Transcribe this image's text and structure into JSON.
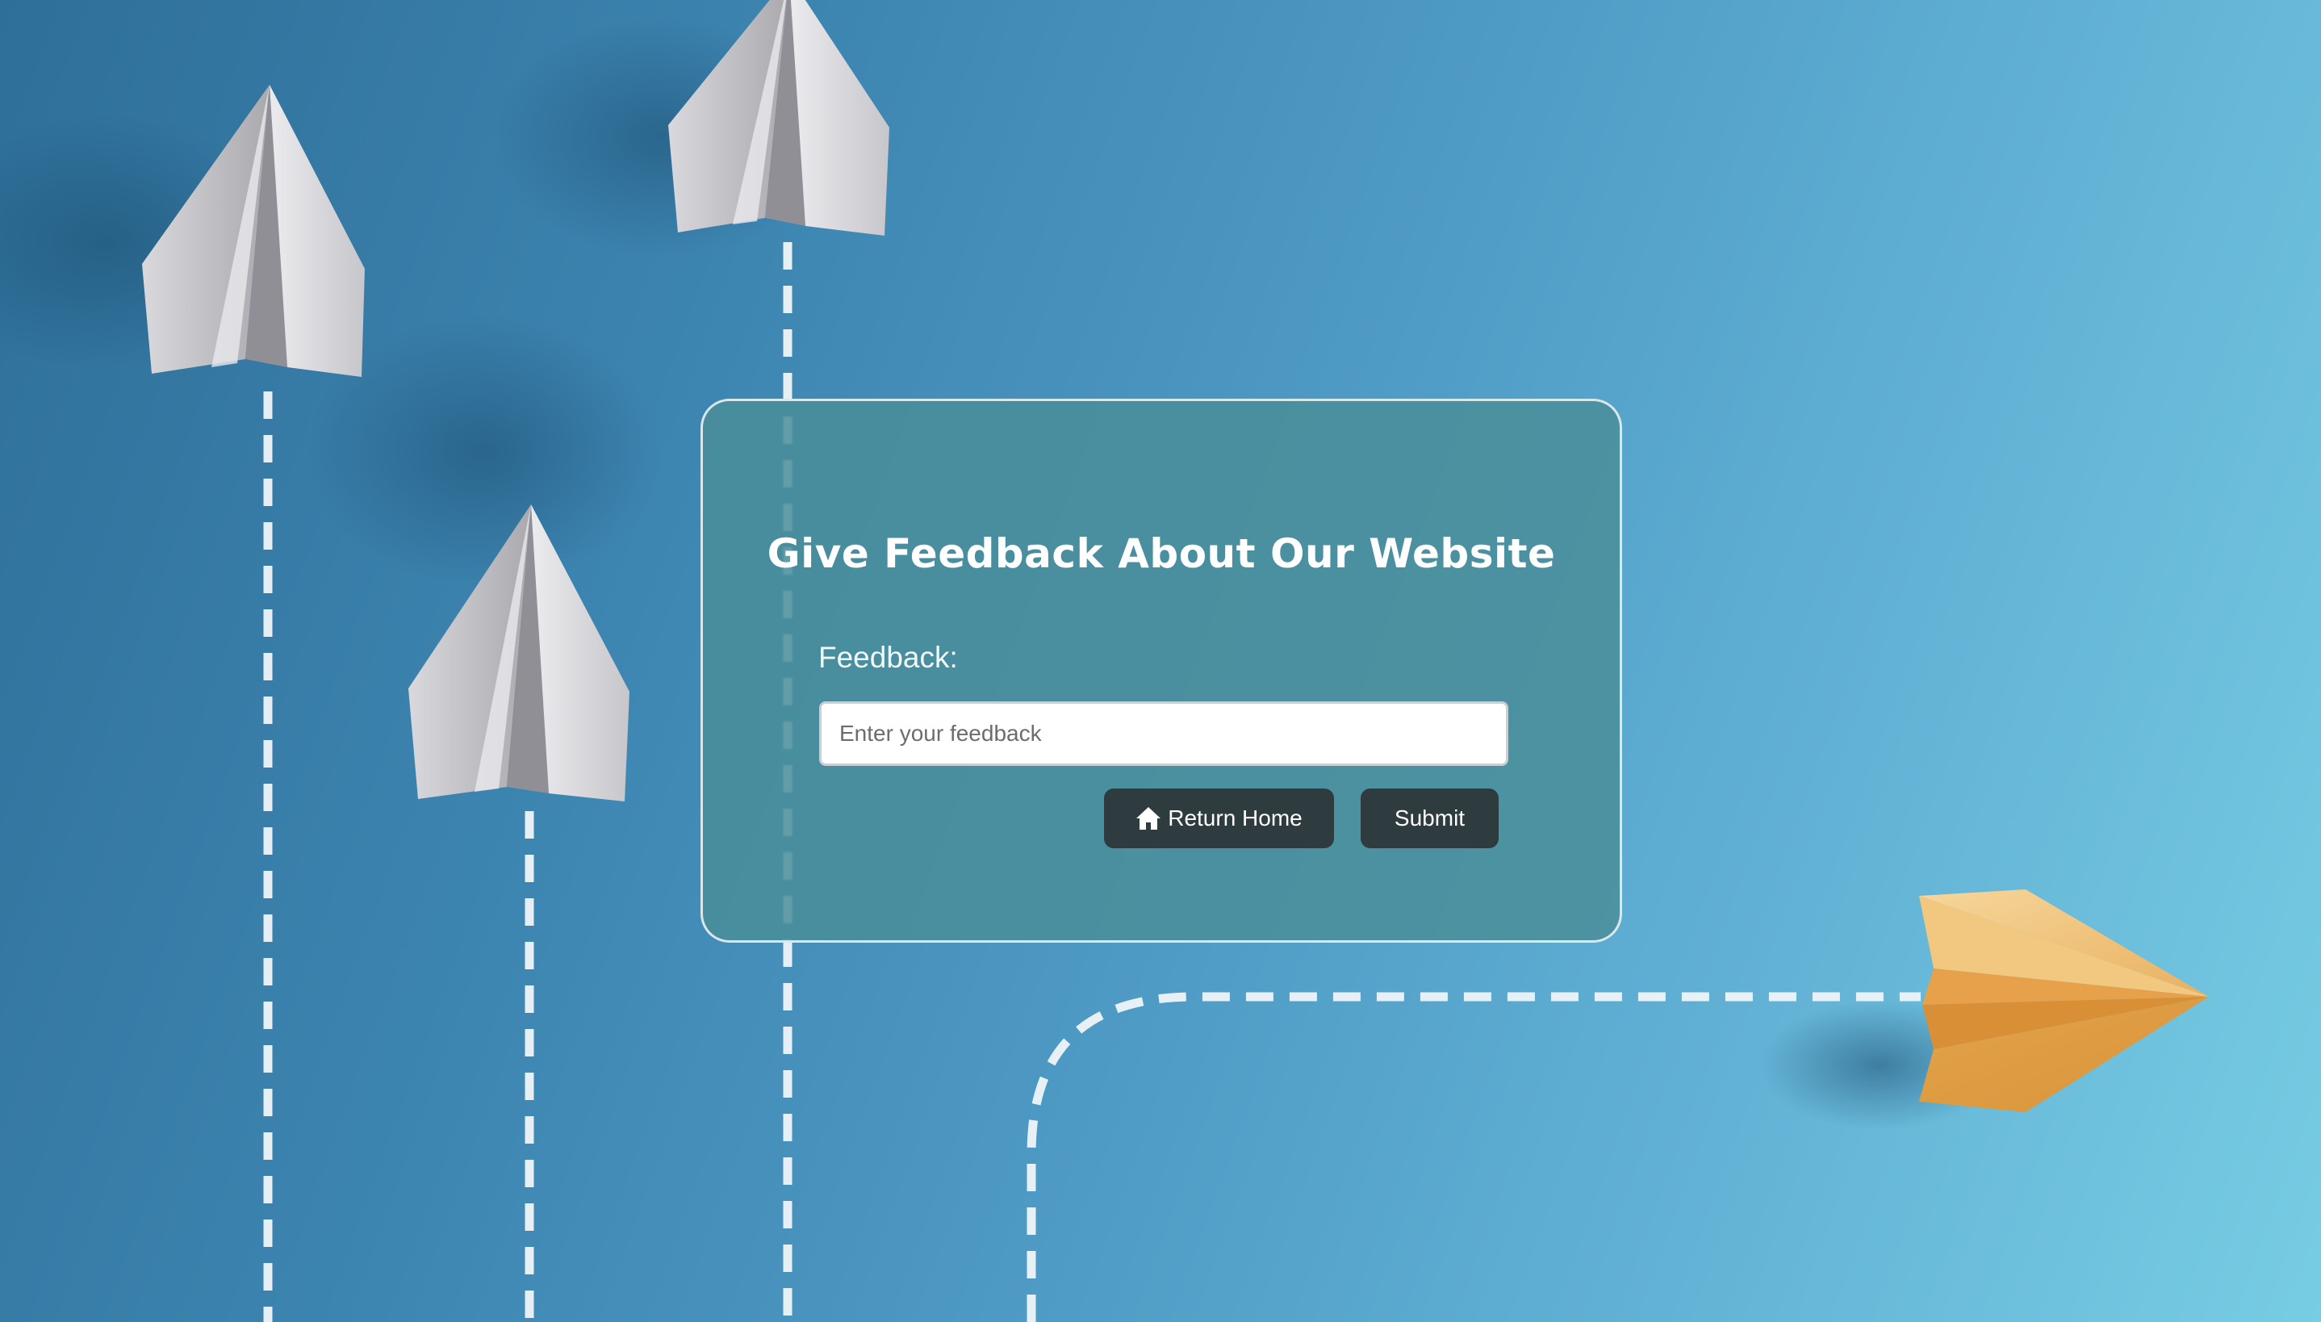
{
  "page": {
    "background_color": "#3c84b0"
  },
  "form": {
    "title": "Give Feedback About Our Website",
    "feedback_label": "Feedback:",
    "feedback_placeholder": "Enter your feedback",
    "feedback_value": "",
    "return_home_label": "Return Home",
    "return_home_icon": "home-icon",
    "submit_label": "Submit",
    "button_color": "#2e3b3f",
    "card_color": "#4a8e99"
  }
}
